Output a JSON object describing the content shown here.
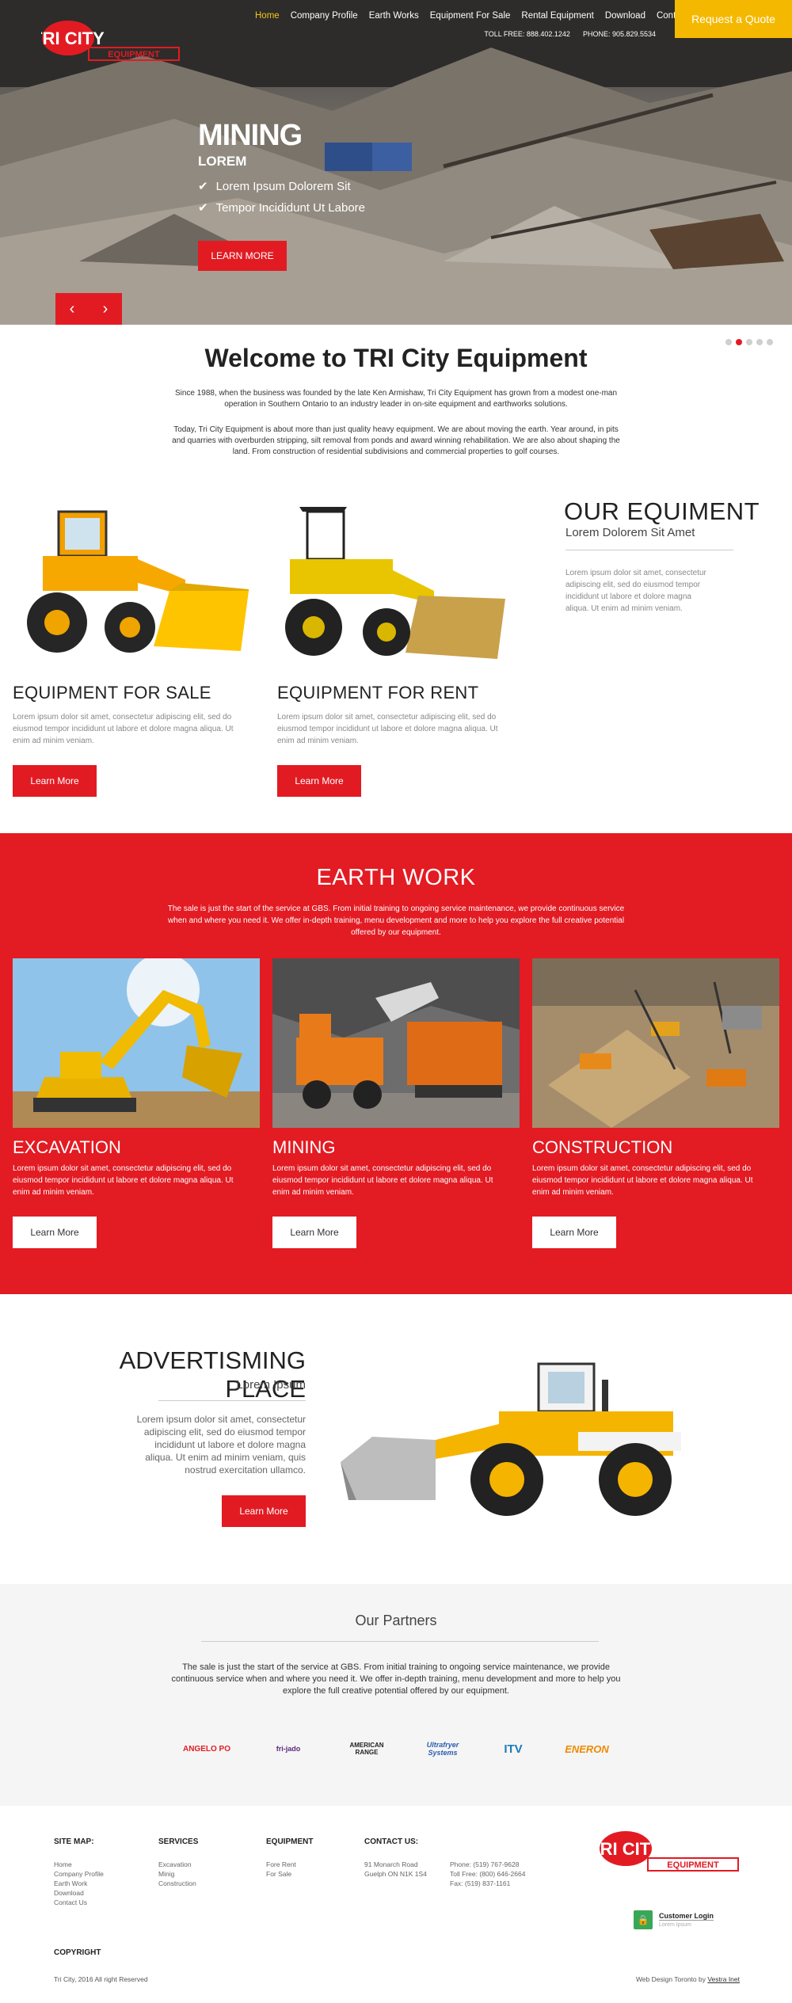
{
  "header": {
    "logo_line1": "TRI CITY",
    "logo_line2": "EQUIPMENT",
    "nav": [
      "Home",
      "Company Profile",
      "Earth Works",
      "Equipment For Sale",
      "Rental Equipment",
      "Download",
      "Contact Us"
    ],
    "nav_active": "Home",
    "toll_free": "TOLL FREE: 888.402.1242",
    "phone": "PHONE: 905.829.5534",
    "quote_button": "Request a Quote"
  },
  "hero": {
    "title": "MINING",
    "subtitle": "LOREM",
    "bullets": [
      "Lorem Ipsum Dolorem Sit",
      "Tempor Incididunt Ut Labore"
    ],
    "button": "LEARN MORE",
    "prev_icon": "‹",
    "next_icon": "›",
    "slide_count": 5,
    "active_slide": 2
  },
  "welcome": {
    "title": "Welcome to TRI City Equipment",
    "paragraph1": "Since 1988, when the business was founded by the late Ken Armishaw, Tri City Equipment has grown from a modest one-man operation in Southern Ontario to an industry leader in on-site equipment and earthworks solutions.",
    "paragraph2": "Today, Tri City Equipment is about more than just quality heavy equipment. We are about moving the earth. Year around, in pits and quarries with overburden stripping, silt removal from ponds and award winning rehabilitation. We are also about shaping the land. From construction of residential subdivisions and commercial properties to golf courses."
  },
  "equipment": {
    "sale_title": "EQUIPMENT FOR SALE",
    "sale_text": "Lorem ipsum dolor sit amet, consectetur adipiscing elit, sed do eiusmod tempor incididunt ut labore et dolore magna aliqua. Ut enim ad minim veniam.",
    "rent_title": "EQUIPMENT FOR RENT",
    "rent_text": "Lorem ipsum dolor sit amet, consectetur adipiscing elit, sed do eiusmod tempor incididunt ut labore et dolore magna aliqua. Ut enim ad minim veniam.",
    "button": "Learn More",
    "our_title": "OUR EQUIMENT",
    "our_subtitle": "Lorem Dolorem Sit Amet",
    "our_text": "Lorem ipsum dolor sit amet, consectetur adipiscing elit, sed do eiusmod tempor incididunt ut labore et dolore magna aliqua. Ut enim ad minim veniam."
  },
  "earthwork": {
    "title": "EARTH WORK",
    "paragraph": "The sale is just the start of the service at GBS. From initial training to ongoing service maintenance, we provide continuous service when and where you need it. We offer in-depth training, menu development and more to help you explore the full creative potential offered by our equipment.",
    "items": [
      {
        "title": "EXCAVATION",
        "text": "Lorem ipsum dolor sit amet, consectetur adipiscing elit, sed do eiusmod tempor incididunt ut labore et dolore magna aliqua. Ut enim ad minim veniam."
      },
      {
        "title": "MINING",
        "text": "Lorem ipsum dolor sit amet, consectetur adipiscing elit, sed do eiusmod tempor incididunt ut labore et dolore magna aliqua. Ut enim ad minim veniam."
      },
      {
        "title": "CONSTRUCTION",
        "text": "Lorem ipsum dolor sit amet, consectetur adipiscing elit, sed do eiusmod tempor incididunt ut labore et dolore magna aliqua. Ut enim ad minim veniam."
      }
    ],
    "button": "Learn More"
  },
  "advert": {
    "title": "ADVERTISMING PLACE",
    "subtitle": "Lorem Ipsum",
    "text": "Lorem ipsum dolor sit amet, consectetur adipiscing elit, sed do eiusmod tempor incididunt ut labore et dolore magna aliqua. Ut enim ad minim veniam, quis nostrud exercitation ullamco.",
    "button": "Learn More"
  },
  "partners": {
    "title": "Our Partners",
    "paragraph": "The sale is just the start of the service at GBS. From initial training to ongoing service maintenance, we provide continuous service when and where you need it. We offer in-depth training, menu development and more to help you explore the full creative potential offered by our equipment.",
    "logos": [
      "ANGELO PO",
      "fri-jado",
      "AMERICAN RANGE",
      "Ultrafryer Systems",
      "ITV",
      "ENERON"
    ]
  },
  "footer": {
    "sitemap_title": "SITE MAP:",
    "sitemap": [
      "Home",
      "Company Profile",
      "Earth Work",
      "Download",
      "Contact Us"
    ],
    "services_title": "SERVICES",
    "services": [
      "Excavation",
      "Minig",
      "Construction"
    ],
    "equipment_title": "EQUIPMENT",
    "equipment": [
      "Fore Rent",
      "For Sale"
    ],
    "contact_title": "CONTACT US:",
    "address": [
      "91 Monarch Road",
      "Guelph ON N1K 1S4"
    ],
    "phones": [
      "Phone: (519) 767-9628",
      "Toll Free: (800) 646-2664",
      "Fax: (519) 837-1161"
    ],
    "login_title": "Customer Login",
    "login_sub": "Lorem Ipsum",
    "copyright_title": "COPYRIGHT",
    "copyright_text": "Tri City, 2016 All right Reserved",
    "credit_text": "Web Design Toronto by",
    "credit_link": "Vestra Inet"
  },
  "colors": {
    "brand_red": "#e21b23",
    "accent_yellow": "#f5b800",
    "nav_active": "#f5c518"
  }
}
